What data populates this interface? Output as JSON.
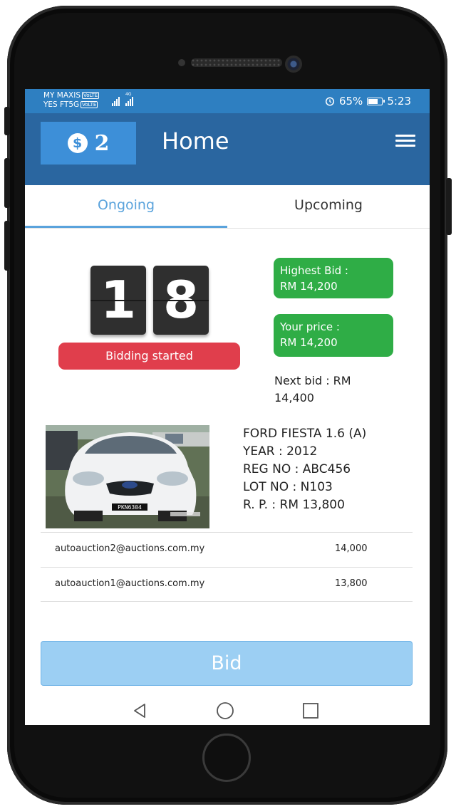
{
  "status_bar": {
    "carrier1": "MY MAXIS",
    "carrier2": "YES FT5G",
    "volte": "VoLTE",
    "network": "4G",
    "battery": "65%",
    "time": "5:23"
  },
  "app_bar": {
    "credits": "2",
    "currency_symbol": "$",
    "title": "Home"
  },
  "tabs": [
    {
      "label": "Ongoing"
    },
    {
      "label": "Upcoming"
    }
  ],
  "auction": {
    "countdown_digit1": "1",
    "countdown_digit2": "8",
    "status": "Bidding started",
    "highest_bid_label": "Highest Bid :",
    "highest_bid_value": "RM 14,200",
    "your_price_label": "Your price :",
    "your_price_value": "RM 14,200",
    "next_bid_line1": "Next bid : RM",
    "next_bid_line2": "14,400"
  },
  "car": {
    "model": "FORD FIESTA 1.6 (A)",
    "year": "YEAR : 2012",
    "reg": "REG NO : ABC456",
    "lot": "LOT NO : N103",
    "rp": "R. P. : RM 13,800",
    "plate": "PKN6304"
  },
  "bids": [
    {
      "email": "autoauction2@auctions.com.my",
      "amount": "14,000"
    },
    {
      "email": "autoauction1@auctions.com.my",
      "amount": "13,800"
    }
  ],
  "bid_button": "Bid",
  "colors": {
    "status_bar": "#2e7fc1",
    "app_bar": "#2a66a0",
    "accent": "#5aa3dc",
    "danger": "#e03e4c",
    "success": "#2fad46",
    "bid_button": "#9ccff3"
  }
}
